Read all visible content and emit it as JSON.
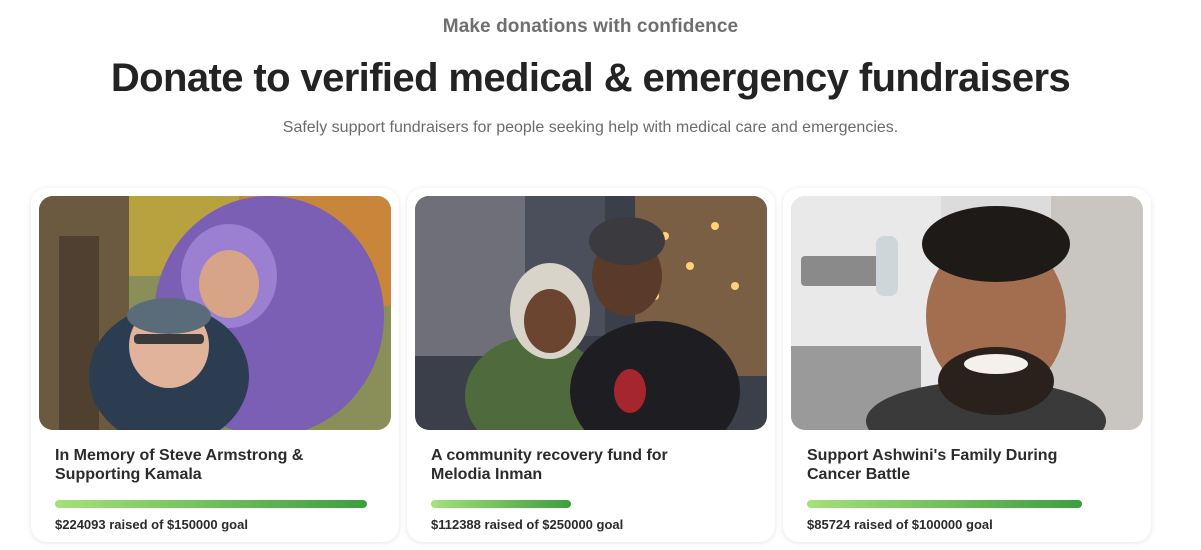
{
  "hero": {
    "eyebrow": "Make donations with confidence",
    "headline": "Donate to verified medical & emergency fundraisers",
    "subhead": "Safely support fundraisers for people seeking help with medical care and emergencies."
  },
  "fundraisers": [
    {
      "title": "In Memory of Steve Armstrong & Supporting Kamala",
      "raised_text": "$224093 raised of $150000 goal",
      "progress": 1.0,
      "image": "couple-in-autumn-park-photo"
    },
    {
      "title": "A community recovery fund for Melodia Inman",
      "raised_text": "$112388 raised of $250000 goal",
      "progress": 0.45,
      "image": "father-and-daughter-city-night-photo"
    },
    {
      "title": "Support Ashwini's Family During Cancer Battle",
      "raised_text": "$85724 raised of $100000 goal",
      "progress": 0.88,
      "image": "smiling-man-indoor-photo"
    }
  ],
  "colors": {
    "progress_start": "#a4e17a",
    "progress_end": "#3c9e3e",
    "headline": "#232323"
  }
}
